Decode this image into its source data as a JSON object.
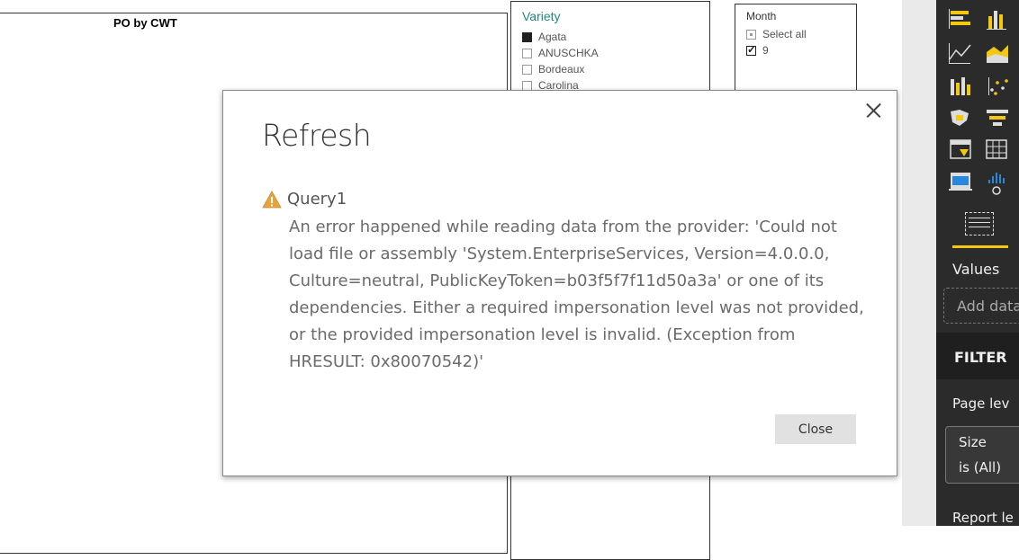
{
  "canvas": {
    "po_visual_title": "PO by CWT",
    "variety_slicer": {
      "header": "Variety",
      "items": [
        {
          "label": "Agata",
          "state": "selected"
        },
        {
          "label": "ANUSCHKA",
          "state": "unselected"
        },
        {
          "label": "Bordeaux",
          "state": "unselected"
        },
        {
          "label": "Carolina",
          "state": "unselected"
        }
      ]
    },
    "month_slicer": {
      "header": "Month",
      "items": [
        {
          "label": "Select all",
          "state": "partial"
        },
        {
          "label": "9",
          "state": "checked"
        }
      ]
    }
  },
  "dialog": {
    "title": "Refresh",
    "query_name": "Query1",
    "error_message": "An error happened while reading data from the provider: 'Could not load file or assembly 'System.EnterpriseServices, Version=4.0.0.0, Culture=neutral, PublicKeyToken=b03f5f7f11d50a3a' or one of its dependencies. Either a required impersonation level was not provided, or the provided impersonation level is invalid. (Exception from HRESULT: 0x80070542)'",
    "close_label": "Close",
    "warning_color": "#e8a33d"
  },
  "right_pane": {
    "values_label": "Values",
    "add_data_placeholder": "Add data",
    "filters_label": "FILTER",
    "page_level_label": "Page lev",
    "size_filter": {
      "field": "Size",
      "condition": "is (All)"
    },
    "report_level_label": "Report le",
    "accent_color": "#f2c811",
    "viz_icons": [
      "stacked-bar-icon",
      "clustered-column-icon",
      "line-chart-icon",
      "area-chart-icon",
      "ribbon-chart-icon",
      "scatter-chart-icon",
      "filled-map-icon",
      "funnel-icon",
      "slicer-icon",
      "table-icon",
      "card-icon",
      "key-influencers-icon"
    ]
  }
}
